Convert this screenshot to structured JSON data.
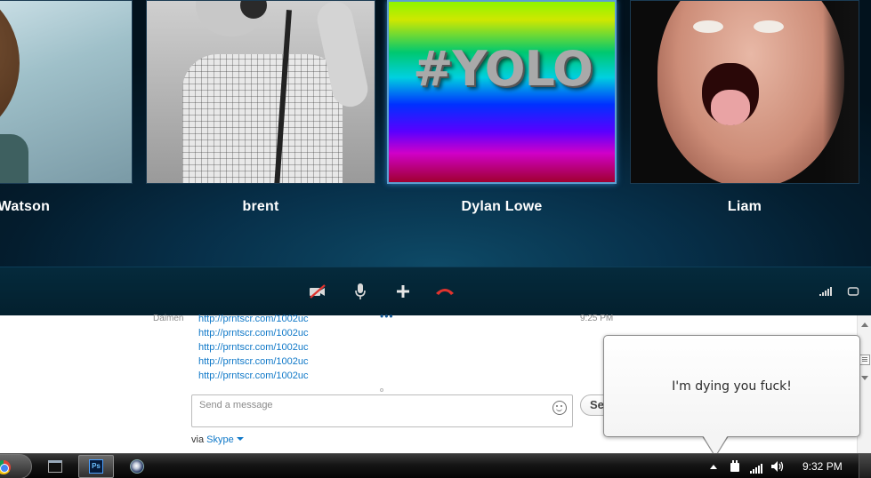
{
  "call": {
    "participants": [
      {
        "name": "y Watson"
      },
      {
        "name": "brent"
      },
      {
        "name": "Dylan Lowe",
        "image_text": "#YOLO",
        "active": true
      },
      {
        "name": "Liam"
      }
    ],
    "controls": [
      {
        "icon": "video-off-icon"
      },
      {
        "icon": "microphone-icon"
      },
      {
        "icon": "add-icon"
      },
      {
        "icon": "hang-up-icon"
      }
    ]
  },
  "chat": {
    "sender": "Daimen",
    "time": "9:25 PM",
    "links": [
      "http://prntscr.com/1002uc",
      "http://prntscr.com/1002uc",
      "http://prntscr.com/1002uc",
      "http://prntscr.com/1002uc",
      "http://prntscr.com/1002uc"
    ],
    "input_placeholder": "Send a message",
    "send_label": "Se",
    "via_prefix": "via",
    "via_service": "Skype"
  },
  "notification": {
    "text": "I'm dying you fuck!"
  },
  "taskbar": {
    "apps": [
      {
        "icon": "chrome-icon"
      },
      {
        "icon": "terminal-icon"
      },
      {
        "icon": "photoshop-icon",
        "label": "Ps",
        "active": true
      },
      {
        "icon": "cinema4d-icon"
      }
    ],
    "clock": "9:32 PM"
  },
  "colors": {
    "call_bg": "#041d2e",
    "link": "#0f78c8",
    "hangup": "#e0332e",
    "active_tile_border": "#5c9fd1"
  }
}
